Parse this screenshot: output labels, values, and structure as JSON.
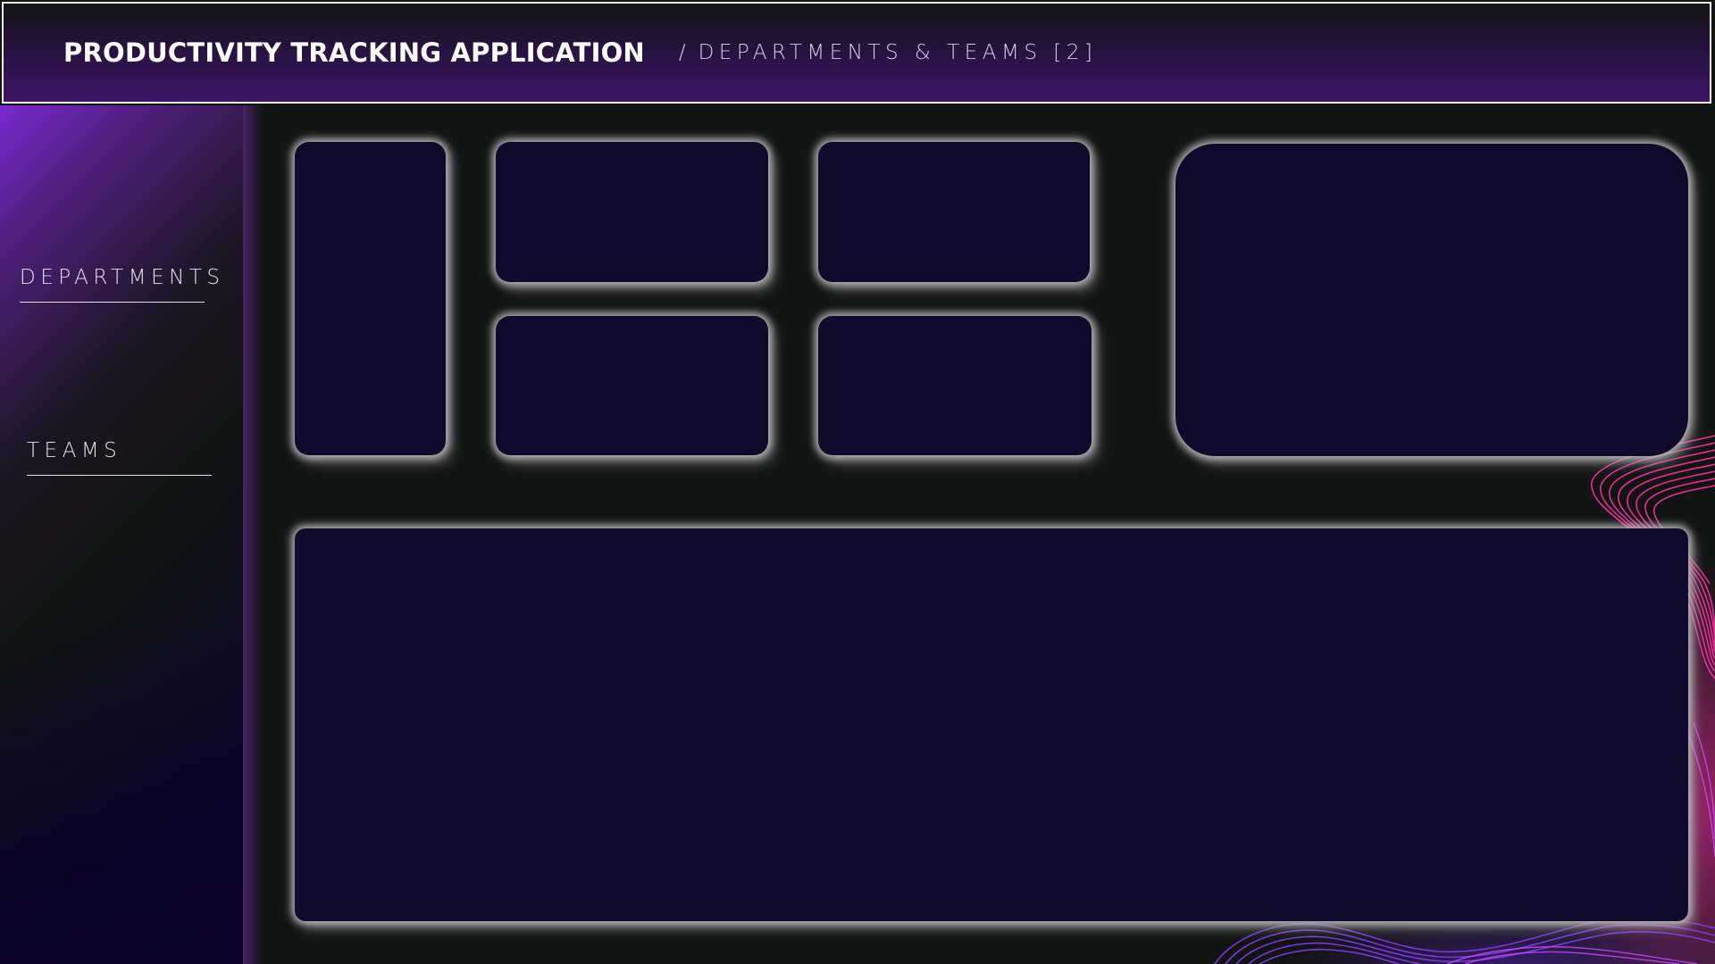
{
  "header": {
    "title": "PRODUCTIVITY TRACKING APPLICATION",
    "separator": "/",
    "subtitle": "DEPARTMENTS & TEAMS [2]"
  },
  "sidebar": {
    "items": [
      {
        "label": "DEPARTMENTS"
      },
      {
        "label": "TEAMS"
      }
    ]
  },
  "colors": {
    "background": "#121413",
    "card": "#0f0a2c",
    "accent_purple": "#7b29cf",
    "accent_pink": "#ff2fa8",
    "header_gradient_end": "#3e1566"
  }
}
